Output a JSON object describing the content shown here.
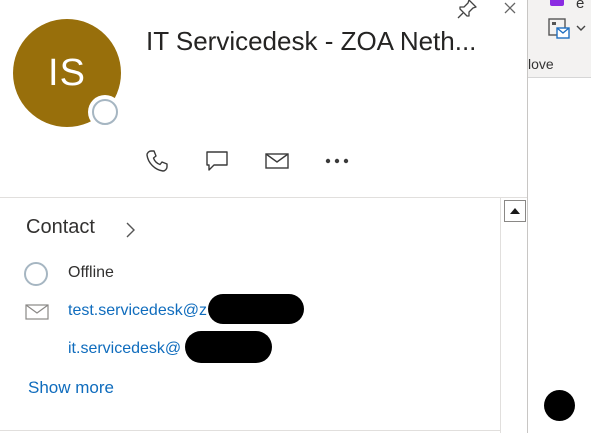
{
  "ribbon": {
    "partial_char": "e",
    "move_label": "Move",
    "move_label_visible": "love"
  },
  "card": {
    "avatar_initials": "IS",
    "avatar_color": "#986f0b",
    "display_name": "IT Servicedesk - ZOA Neth...",
    "presence_status": "offline",
    "icons": {
      "pin": "pin-icon",
      "close": "close-icon",
      "call": "phone-icon",
      "chat": "chat-icon",
      "mail": "mail-icon",
      "more": "more-icon"
    },
    "contact_section": {
      "title": "Contact",
      "status_text": "Offline",
      "emails": [
        "test.servicedesk@z",
        "it.servicedesk@"
      ],
      "show_more": "Show more"
    }
  },
  "colors": {
    "link": "#0f6cbd",
    "presence_ring": "#a6b6c2"
  }
}
